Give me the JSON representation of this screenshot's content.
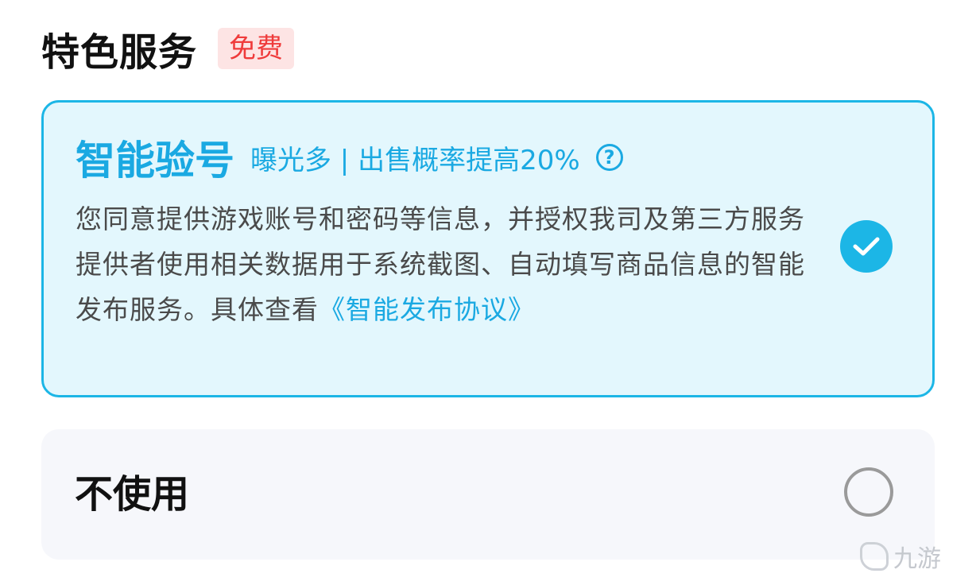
{
  "header": {
    "title": "特色服务",
    "badge": "免费"
  },
  "options": [
    {
      "name": "智能验号",
      "tagline": "曝光多 | 出售概率提高20%",
      "help_glyph": "?",
      "description": "您同意提供游戏账号和密码等信息，并授权我司及第三方服务提供者使用相关数据用于系统截图、自动填写商品信息的智能发布服务。具体查看",
      "link_text": "《智能发布协议》",
      "selected": true
    },
    {
      "name": "不使用",
      "selected": false
    }
  ],
  "icons": {
    "help": "help-icon",
    "check": "check-circle-icon",
    "radio": "radio-unchecked-icon"
  },
  "watermark": {
    "text": "九游"
  },
  "colors": {
    "accent": "#1cb6e6",
    "accent_text": "#1aa9e2",
    "selected_bg": "#e3f7fd",
    "unselected_bg": "#f6f7fb",
    "badge_bg": "#fde4e4",
    "badge_text": "#ef3b3b"
  }
}
